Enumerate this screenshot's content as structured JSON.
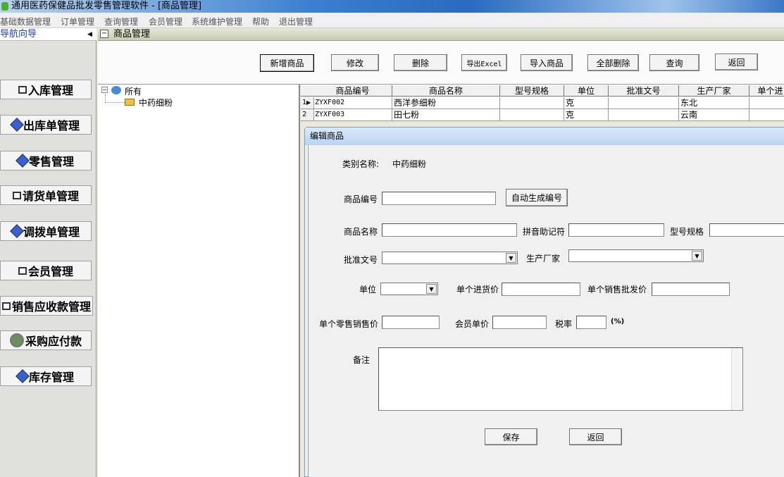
{
  "window": {
    "title": "通用医药保健品批发零售管理软件   - [商品管理]"
  },
  "menu": [
    "基础数据管理",
    "订单管理",
    "查询管理",
    "会员管理",
    "系统维护管理",
    "帮助",
    "退出管理"
  ],
  "nav": {
    "title": "导航向导",
    "items": [
      "入库管理",
      "出库单管理",
      "零售管理",
      "请货单管理",
      "调拨单管理",
      "会员管理",
      "销售应收款管理",
      "采购应付款",
      "库存管理"
    ]
  },
  "main": {
    "title": "商品管理"
  },
  "toolbar": [
    "新增商品",
    "修改",
    "删除",
    "导出Excel",
    "导入商品",
    "全部删除",
    "查询",
    "返回"
  ],
  "tree": {
    "root": "所有",
    "child": "中药细粉"
  },
  "grid": {
    "columns": [
      "商品编号",
      "商品名称",
      "型号规格",
      "单位",
      "批准文号",
      "生产厂家",
      "单个进"
    ],
    "rows": [
      {
        "n": "1",
        "cells": [
          "ZYXF002",
          "西洋参细粉",
          "",
          "克",
          "",
          "东北",
          ""
        ]
      },
      {
        "n": "2",
        "cells": [
          "ZYXF003",
          "田七粉",
          "",
          "克",
          "",
          "云南",
          ""
        ]
      }
    ]
  },
  "dialog": {
    "title": "编辑商品",
    "category_label": "类别名称:",
    "category_value": "中药细粉",
    "code_label": "商品编号",
    "auto_code": "自动生成编号",
    "name_label": "商品名称",
    "pinyin_label": "拼音助记符",
    "spec_label": "型号规格",
    "approval_label": "批准文号",
    "maker_label": "生产厂家",
    "unit_label": "单位",
    "purchase_label": "单个进货价",
    "wholesale_label": "单个销售批发价",
    "retail_label": "单个零售销售价",
    "member_label": "会员单价",
    "tax_label": "税率",
    "tax_unit": "(%)",
    "note_label": "备注",
    "save": "保存",
    "back": "返回"
  }
}
